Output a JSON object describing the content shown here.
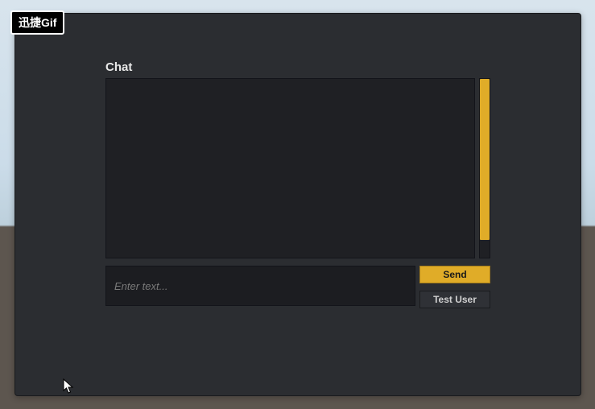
{
  "badge": {
    "label": "迅捷Gif"
  },
  "chat": {
    "title": "Chat",
    "input_placeholder": "Enter text...",
    "input_value": "",
    "send_label": "Send",
    "test_user_label": "Test User"
  }
}
